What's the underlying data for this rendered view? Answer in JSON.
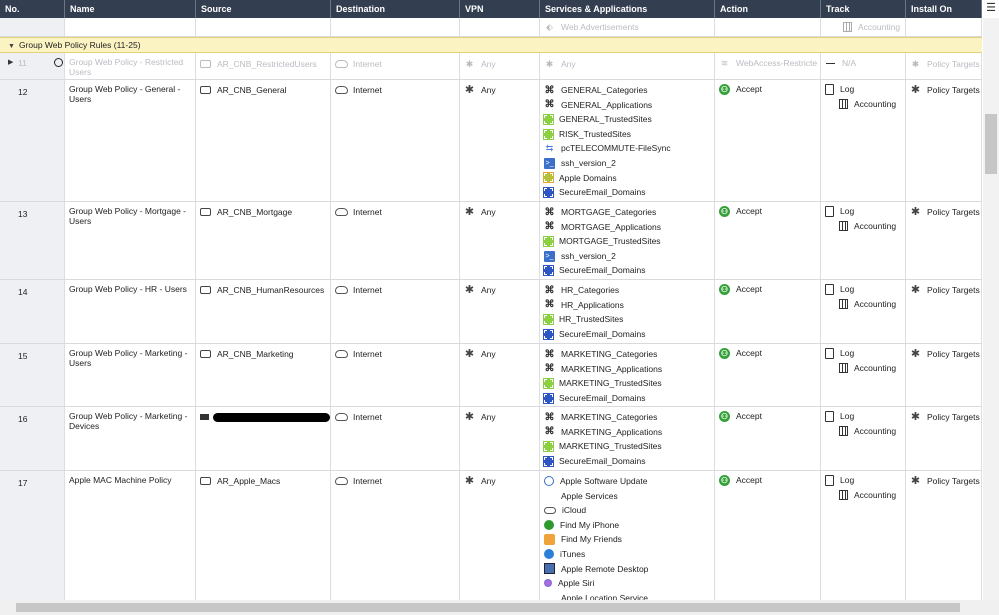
{
  "columns": [
    "No.",
    "Name",
    "Source",
    "Destination",
    "VPN",
    "Services & Applications",
    "Action",
    "Track",
    "Install On"
  ],
  "partial_row": {
    "service": "Web Advertisements",
    "track": "Accounting"
  },
  "section": {
    "label": "Group Web Policy Rules",
    "range": "(11-25)"
  },
  "rows": [
    {
      "no": "11",
      "name": "Group Web Policy - Restricted Users",
      "source": "AR_CNB_RestrictedUsers",
      "destination": "Internet",
      "vpn": "Any",
      "services": [
        {
          "label": "Any",
          "icon": "asterisk-icon"
        }
      ],
      "action": "WebAccess-Restricte",
      "track": [
        "N/A"
      ],
      "install_on": "Policy Targets",
      "disabled": true
    },
    {
      "no": "12",
      "name": "Group Web Policy - General - Users",
      "source": "AR_CNB_General",
      "destination": "Internet",
      "vpn": "Any",
      "services": [
        {
          "label": "GENERAL_Categories",
          "icon": "category-icon"
        },
        {
          "label": "GENERAL_Applications",
          "icon": "category-icon"
        },
        {
          "label": "GENERAL_TrustedSites",
          "icon": "site-group-green-icon"
        },
        {
          "label": "RISK_TrustedSites",
          "icon": "site-group-green-icon"
        },
        {
          "label": "pcTELECOMMUTE-FileSync",
          "icon": "sync-icon"
        },
        {
          "label": "ssh_version_2",
          "icon": "ssh-icon"
        },
        {
          "label": "Apple Domains",
          "icon": "site-group-olive-icon"
        },
        {
          "label": "SecureEmail_Domains",
          "icon": "site-group-blue-icon"
        }
      ],
      "action": "Accept",
      "track": [
        "Log",
        "Accounting"
      ],
      "install_on": "Policy Targets"
    },
    {
      "no": "13",
      "name": "Group Web Policy - Mortgage - Users",
      "source": "AR_CNB_Mortgage",
      "destination": "Internet",
      "vpn": "Any",
      "services": [
        {
          "label": "MORTGAGE_Categories",
          "icon": "category-icon"
        },
        {
          "label": "MORTGAGE_Applications",
          "icon": "category-icon"
        },
        {
          "label": "MORTGAGE_TrustedSites",
          "icon": "site-group-green-icon"
        },
        {
          "label": "ssh_version_2",
          "icon": "ssh-icon"
        },
        {
          "label": "SecureEmail_Domains",
          "icon": "site-group-blue-icon"
        }
      ],
      "action": "Accept",
      "track": [
        "Log",
        "Accounting"
      ],
      "install_on": "Policy Targets"
    },
    {
      "no": "14",
      "name": "Group Web Policy - HR - Users",
      "source": "AR_CNB_HumanResources",
      "destination": "Internet",
      "vpn": "Any",
      "services": [
        {
          "label": "HR_Categories",
          "icon": "category-icon"
        },
        {
          "label": "HR_Applications",
          "icon": "category-icon"
        },
        {
          "label": "HR_TrustedSites",
          "icon": "site-group-green-icon"
        },
        {
          "label": "SecureEmail_Domains",
          "icon": "site-group-blue-icon"
        }
      ],
      "action": "Accept",
      "track": [
        "Log",
        "Accounting"
      ],
      "install_on": "Policy Targets"
    },
    {
      "no": "15",
      "name": "Group Web Policy - Marketing - Users",
      "source": "AR_CNB_Marketing",
      "destination": "Internet",
      "vpn": "Any",
      "services": [
        {
          "label": "MARKETING_Categories",
          "icon": "category-icon"
        },
        {
          "label": "MARKETING_Applications",
          "icon": "category-icon"
        },
        {
          "label": "MARKETING_TrustedSites",
          "icon": "site-group-green-icon"
        },
        {
          "label": "SecureEmail_Domains",
          "icon": "site-group-blue-icon"
        }
      ],
      "action": "Accept",
      "track": [
        "Log",
        "Accounting"
      ],
      "install_on": "Policy Targets"
    },
    {
      "no": "16",
      "name": "Group Web Policy - Marketing - Devices",
      "source": "",
      "destination": "Internet",
      "vpn": "Any",
      "services": [
        {
          "label": "MARKETING_Categories",
          "icon": "category-icon"
        },
        {
          "label": "MARKETING_Applications",
          "icon": "category-icon"
        },
        {
          "label": "MARKETING_TrustedSites",
          "icon": "site-group-green-icon"
        },
        {
          "label": "SecureEmail_Domains",
          "icon": "site-group-blue-icon"
        }
      ],
      "action": "Accept",
      "track": [
        "Log",
        "Accounting"
      ],
      "install_on": "Policy Targets",
      "source_redacted": true
    },
    {
      "no": "17",
      "name": "Apple MAC Machine Policy",
      "source": "AR_Apple_Macs",
      "destination": "Internet",
      "vpn": "Any",
      "services": [
        {
          "label": "Apple Software Update",
          "icon": "software-update-icon"
        },
        {
          "label": "Apple Services",
          "icon": "apple-icon"
        },
        {
          "label": "iCloud",
          "icon": "icloud-icon"
        },
        {
          "label": "Find My iPhone",
          "icon": "find-my-iphone-icon"
        },
        {
          "label": "Find My Friends",
          "icon": "find-my-friends-icon"
        },
        {
          "label": "iTunes",
          "icon": "itunes-icon"
        },
        {
          "label": "Apple Remote Desktop",
          "icon": "remote-desktop-icon"
        },
        {
          "label": "Apple Siri",
          "icon": "siri-icon"
        },
        {
          "label": "Apple Location Service",
          "icon": "apple-icon"
        }
      ],
      "action": "Accept",
      "track": [
        "Log",
        "Accounting"
      ],
      "install_on": "Policy Targets"
    }
  ],
  "colors": {
    "header_bg": "#333e50",
    "section_bg": "#fbf3c2",
    "accept_green": "#36a13a",
    "disabled_text": "#b9bcc2"
  }
}
